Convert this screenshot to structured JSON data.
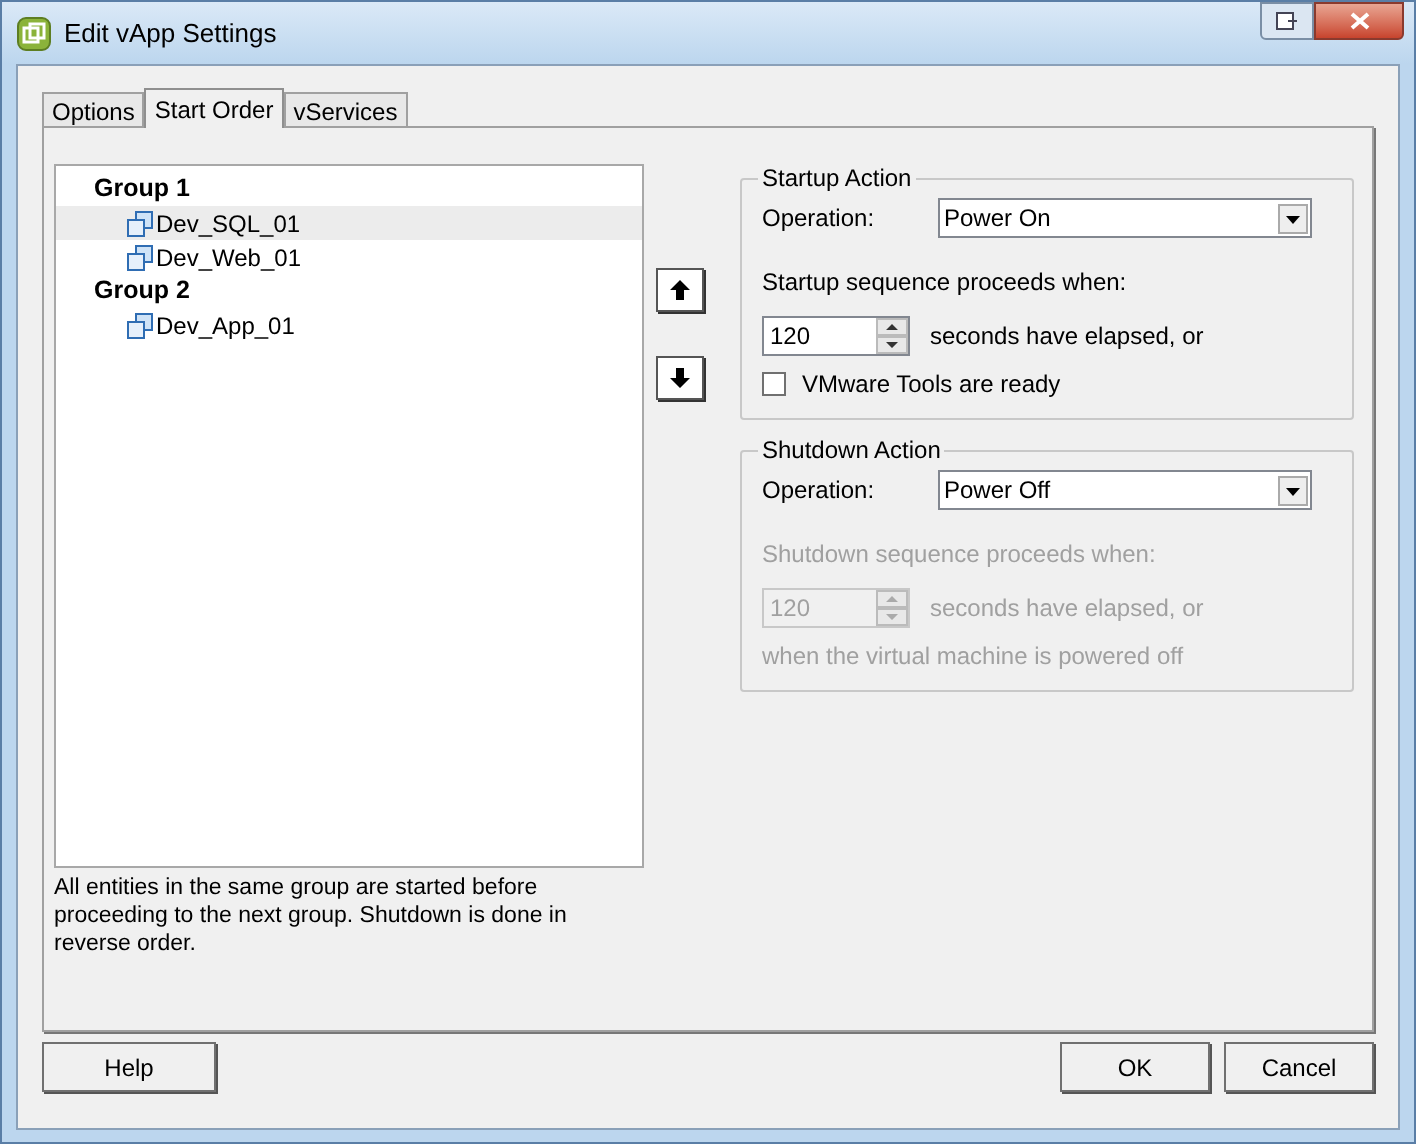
{
  "window": {
    "title": "Edit vApp Settings"
  },
  "tabs": [
    {
      "label": "Options",
      "selected": false
    },
    {
      "label": "Start Order",
      "selected": true
    },
    {
      "label": "vServices",
      "selected": false
    }
  ],
  "tree": [
    {
      "label": "Group 1",
      "children": [
        {
          "label": "Dev_SQL_01",
          "selected": true
        },
        {
          "label": "Dev_Web_01",
          "selected": false
        }
      ]
    },
    {
      "label": "Group 2",
      "children": [
        {
          "label": "Dev_App_01",
          "selected": false
        }
      ]
    }
  ],
  "note": "All entities in the same group are started before proceeding to the next group. Shutdown is done in reverse order.",
  "sections": [
    {
      "title": "Startup Action",
      "operation_label": "Operation:",
      "operation_value": "Power On",
      "sequence_label": "Startup sequence proceeds when:",
      "seconds_value": "120",
      "seconds_label": "seconds have elapsed, or",
      "disabled": false,
      "condition": {
        "kind": "checkbox",
        "label": "VMware Tools are ready",
        "checked": false
      }
    },
    {
      "title": "Shutdown Action",
      "operation_label": "Operation:",
      "operation_value": "Power Off",
      "sequence_label": "Shutdown sequence proceeds when:",
      "seconds_value": "120",
      "seconds_label": "seconds have elapsed, or",
      "disabled": true,
      "condition": {
        "kind": "text",
        "label": "when the virtual machine is powered off"
      }
    }
  ],
  "buttons": [
    {
      "label": "Help"
    },
    {
      "label": "OK"
    },
    {
      "label": "Cancel"
    }
  ]
}
